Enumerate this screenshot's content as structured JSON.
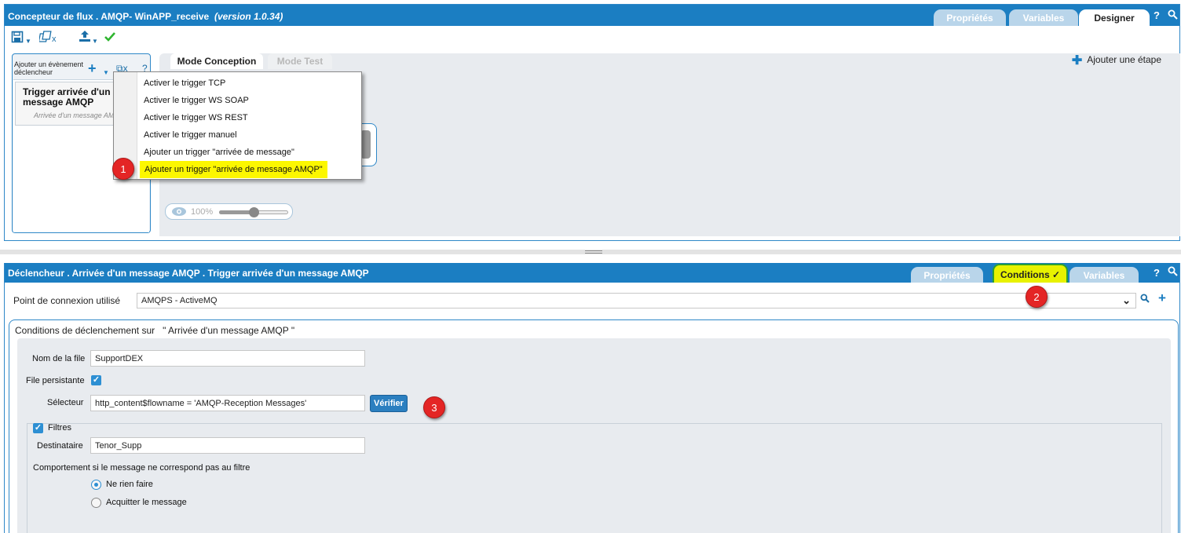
{
  "flow_designer": {
    "title": "Concepteur de flux . AMQP- WinAPP_receive",
    "version": "(version 1.0.34)",
    "tabs": [
      "Propriétés",
      "Variables",
      "Designer"
    ],
    "active_tab": "Designer",
    "help_glyph": "?",
    "toolbar_icons": [
      "save-icon",
      "dropdown-arrow-icon",
      "copy-delete-icon",
      "upload-icon",
      "checkmark-icon"
    ],
    "trigger_panel": {
      "header": "Ajouter un évènement déclencheur",
      "item_title": "Trigger arrivée d'un message AMQP",
      "item_subtitle": "Arrivée d'un message AMQP"
    },
    "modes": [
      "Mode Conception",
      "Mode Test"
    ],
    "add_step_label": "Ajouter une étape",
    "zoom_label": "100%",
    "zoom_level": 0.5,
    "menu_items": [
      "Activer le trigger TCP",
      "Activer le trigger WS SOAP",
      "Activer le trigger WS REST",
      "Activer le trigger manuel",
      "Ajouter un trigger \"arrivée de message\"",
      "Ajouter un trigger \"arrivée de message AMQP\""
    ]
  },
  "badges": [
    "1",
    "2",
    "3"
  ],
  "trigger_details": {
    "title": "Déclencheur . Arrivée d'un message AMQP . Trigger arrivée d'un message AMQP",
    "tabs": [
      "Propriétés",
      "Conditions ✓",
      "Variables"
    ],
    "active_tab": "Conditions ✓",
    "connection_label": "Point de connexion utilisé",
    "connection_value": "AMQPS - ActiveMQ",
    "conditions_title": "Conditions de déclenchement sur   \" Arrivée d'un message AMQP \"",
    "queue_name_label": "Nom de la file",
    "queue_name_value": "SupportDEX",
    "persistent_label": "File persistante",
    "persistent_checked": true,
    "selector_label": "Sélecteur",
    "selector_value": "http_content$flowname = 'AMQP-Reception Messages'",
    "verify_button": "Vérifier",
    "filters_label": "Filtres",
    "filters_checked": true,
    "recipient_label": "Destinataire",
    "recipient_value": "Tenor_Supp",
    "behavior_label": "Comportement si le message ne correspond pas au filtre",
    "behavior_options": [
      "Ne rien faire",
      "Acquitter le message"
    ],
    "behavior_selected": "Ne rien faire"
  },
  "colors": {
    "titlebar": "#1b7ec2",
    "highlight": "#fcf700",
    "badge": "#e42525",
    "checkbox": "#2d8fd3"
  }
}
